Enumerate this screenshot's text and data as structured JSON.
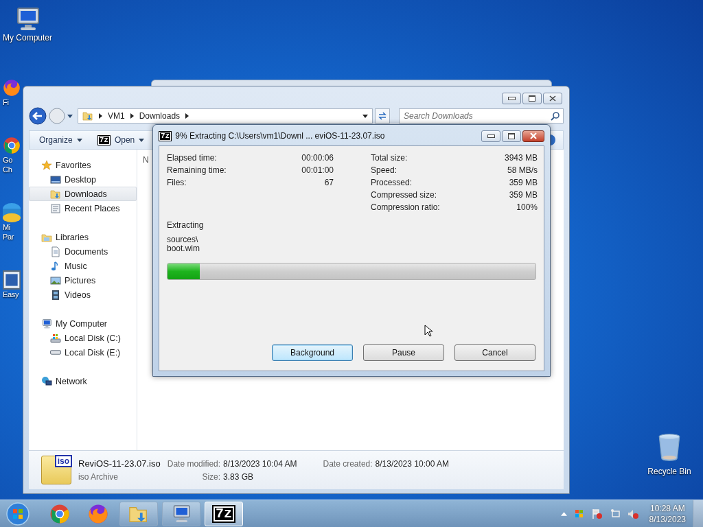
{
  "desktop_icons": [
    {
      "kind": "computer",
      "lines": [
        "My Computer"
      ]
    },
    {
      "kind": "firefox",
      "lines": [
        "Fi"
      ]
    },
    {
      "kind": "chrome",
      "lines": [
        "Go",
        "Ch"
      ]
    },
    {
      "kind": "app",
      "lines": [
        "Mi",
        "Par"
      ]
    },
    {
      "kind": "monitor",
      "lines": [
        "Easy"
      ]
    }
  ],
  "recycle_bin": {
    "label": "Recycle Bin"
  },
  "explorer": {
    "breadcrumb": [
      "VM1",
      "Downloads"
    ],
    "search": {
      "placeholder": "Search Downloads"
    },
    "toolbar": [
      {
        "label": "Organize",
        "kind": "menu"
      },
      {
        "label": "Open",
        "kind": "sevenzip",
        "icon_text": "7z"
      }
    ],
    "nav": [
      {
        "label": "Favorites",
        "kind": "star",
        "selected": false,
        "children": [
          {
            "label": "Desktop",
            "kind": "desktop",
            "selected": false
          },
          {
            "label": "Downloads",
            "kind": "downloads",
            "selected": true
          },
          {
            "label": "Recent Places",
            "kind": "recent",
            "selected": false
          }
        ]
      },
      {
        "label": "Libraries",
        "kind": "library",
        "selected": false,
        "children": [
          {
            "label": "Documents",
            "kind": "document",
            "selected": false
          },
          {
            "label": "Music",
            "kind": "music",
            "selected": false
          },
          {
            "label": "Pictures",
            "kind": "pictures",
            "selected": false
          },
          {
            "label": "Videos",
            "kind": "videos",
            "selected": false
          }
        ]
      },
      {
        "label": "My Computer",
        "kind": "computer",
        "selected": false,
        "children": [
          {
            "label": "Local Disk (C:)",
            "kind": "sysdisk",
            "selected": false
          },
          {
            "label": "Local Disk (E:)",
            "kind": "disk",
            "selected": false
          }
        ]
      },
      {
        "label": "Network",
        "kind": "network",
        "selected": false
      }
    ],
    "column_fragment": "N",
    "details": {
      "name": "ReviOS-11-23.07.iso",
      "type": "iso Archive",
      "icon_text": "iso",
      "fields": [
        {
          "label": "Date modified:",
          "value": "8/13/2023 10:04 AM"
        },
        {
          "label": "Date created:",
          "value": "8/13/2023 10:00 AM"
        },
        {
          "label": "Size:",
          "value": "3.83 GB"
        }
      ]
    }
  },
  "dialog": {
    "icon_text": "7z",
    "title": "9% Extracting C:\\Users\\vm1\\Downl ... eviOS-11-23.07.iso",
    "left_stats": [
      {
        "label": "Elapsed time:",
        "value": "00:00:06"
      },
      {
        "label": "Remaining time:",
        "value": "00:01:00"
      },
      {
        "label": "Files:",
        "value": "67"
      }
    ],
    "right_stats": [
      {
        "label": "Total size:",
        "value": "3943 MB"
      },
      {
        "label": "Speed:",
        "value": "58 MB/s"
      },
      {
        "label": "Processed:",
        "value": "359 MB"
      },
      {
        "label": "Compressed size:",
        "value": "359 MB"
      },
      {
        "label": "Compression ratio:",
        "value": "100%"
      }
    ],
    "status": "Extracting",
    "path_lines": [
      "sources\\",
      "boot.wim"
    ],
    "progress": {
      "level": 0.087
    },
    "buttons": [
      {
        "label": "Background",
        "selected": true
      },
      {
        "label": "Pause",
        "selected": false
      },
      {
        "label": "Cancel",
        "selected": false
      }
    ]
  },
  "taskbar": {
    "items": [
      {
        "kind": "chrome",
        "active": false
      },
      {
        "kind": "firefox",
        "active": false
      },
      {
        "kind": "folder",
        "active": false
      },
      {
        "kind": "computer",
        "active": false
      },
      {
        "kind": "sevenzip",
        "active": true,
        "text": "7z"
      }
    ],
    "clock": {
      "time": "10:28 AM",
      "date": "8/13/2023"
    }
  }
}
